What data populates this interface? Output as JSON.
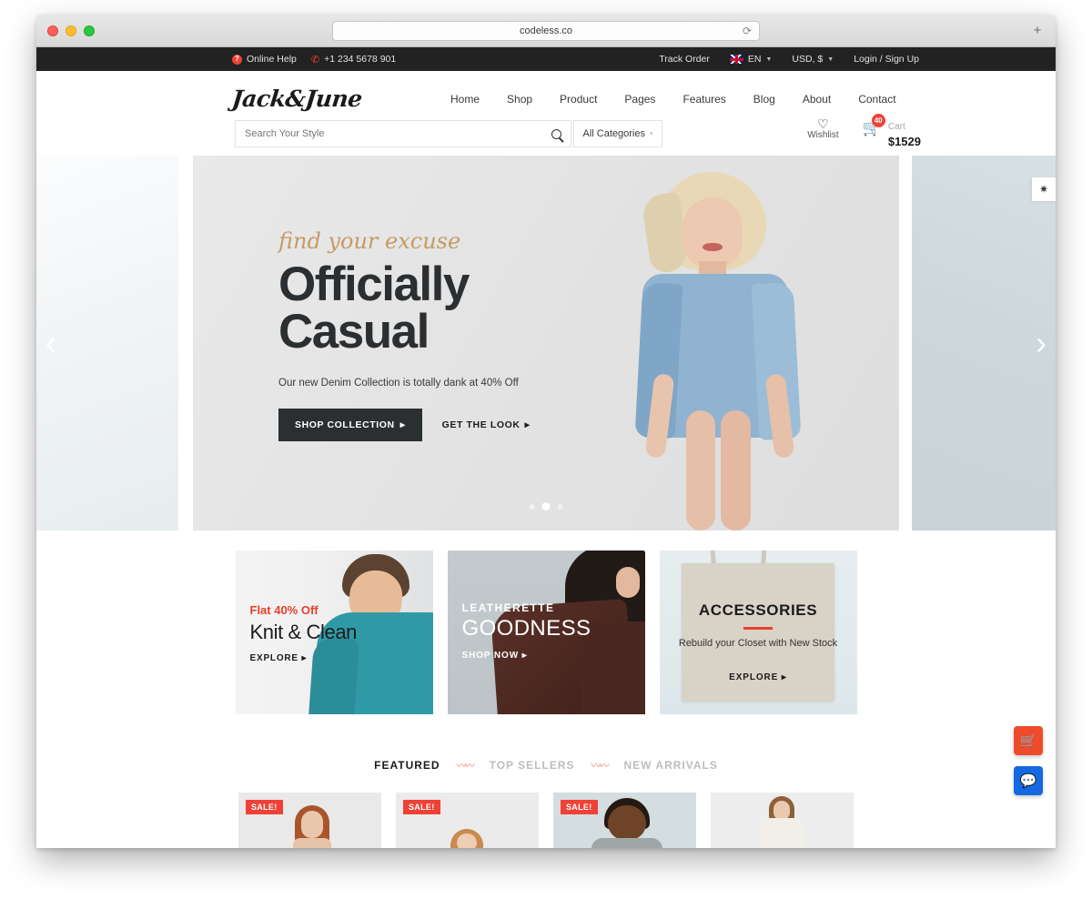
{
  "browser": {
    "url": "codeless.co",
    "reload_icon": "reload-icon",
    "newtab_label": "+",
    "traffic_lights": [
      "close",
      "minimize",
      "maximize"
    ]
  },
  "topbar": {
    "online_help": "Online Help",
    "help_icon": "?",
    "phone": "+1 234 5678 901",
    "phone_icon": "phone-icon",
    "track_order": "Track Order",
    "language": "EN",
    "currency": "USD, $",
    "account": "Login / Sign Up",
    "caret": "▼"
  },
  "header": {
    "logo": "Jack&June",
    "nav": [
      {
        "label": "Home"
      },
      {
        "label": "Shop"
      },
      {
        "label": "Product"
      },
      {
        "label": "Pages"
      },
      {
        "label": "Features"
      },
      {
        "label": "Blog"
      },
      {
        "label": "About"
      },
      {
        "label": "Contact"
      }
    ],
    "search": {
      "placeholder": "Search Your Style",
      "value": "",
      "icon": "search-icon"
    },
    "categories": {
      "label": "All Categories",
      "caret": "▾"
    },
    "wishlist": {
      "label": "Wishlist",
      "icon": "heart-icon"
    },
    "cart": {
      "label": "Cart",
      "price": "$1529",
      "count": "40",
      "icon": "cart-icon"
    }
  },
  "hero": {
    "kicker": "find your excuse",
    "title_line1": "Officially",
    "title_line2": "Casual",
    "subtitle": "Our new Denim Collection is totally dank at 40% Off",
    "primary_cta": "SHOP COLLECTION",
    "primary_cta_arrow": "▸",
    "secondary_cta": "GET THE LOOK",
    "secondary_cta_arrow": "▸",
    "prev_arrow": "‹",
    "next_arrow": "›",
    "dots": [
      {
        "active": false
      },
      {
        "active": true
      },
      {
        "active": false
      }
    ],
    "settings_icon": "gear-icon"
  },
  "promos": [
    {
      "kicker": "Flat 40% Off",
      "title": "Knit & Clean",
      "link": "EXPLORE",
      "arrow": "▸"
    },
    {
      "kicker": "LEATHERETTE",
      "title": "GOODNESS",
      "link": "SHOP NOW",
      "arrow": "▸"
    },
    {
      "title": "ACCESSORIES",
      "sub": "Rebuild your Closet with New Stock",
      "link": "EXPLORE",
      "arrow": "▸"
    }
  ],
  "featured": {
    "tabs": [
      {
        "label": "FEATURED",
        "active": true
      },
      {
        "label": "TOP SELLERS",
        "active": false
      },
      {
        "label": "NEW ARRIVALS",
        "active": false
      }
    ],
    "separator": "〰〰",
    "products": [
      {
        "badge": "SALE!"
      },
      {
        "badge": "SALE!"
      },
      {
        "badge": "SALE!"
      },
      {
        "badge": ""
      }
    ]
  },
  "float_buttons": [
    {
      "icon": "cart-icon",
      "glyph": "🛒",
      "color": "#ee4b2b"
    },
    {
      "icon": "chat-icon",
      "glyph": "💬",
      "color": "#1569e0"
    }
  ]
}
